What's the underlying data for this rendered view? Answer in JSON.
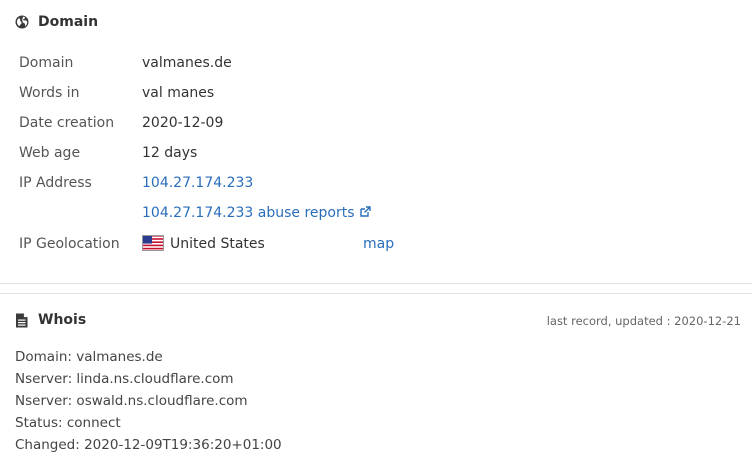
{
  "domain_section": {
    "title": "Domain",
    "rows": {
      "domain": {
        "label": "Domain",
        "value": "valmanes.de"
      },
      "words": {
        "label": "Words in",
        "value": "val manes"
      },
      "date_creation": {
        "label": "Date creation",
        "value": "2020-12-09"
      },
      "web_age": {
        "label": "Web age",
        "value": "12 days"
      },
      "ip_address": {
        "label": "IP Address",
        "value": "104.27.174.233"
      },
      "abuse": {
        "value": "104.27.174.233 abuse reports"
      },
      "geolocation": {
        "label": "IP Geolocation",
        "country": "United States",
        "map_label": "map"
      }
    },
    "icons": {
      "section": "globe-icon",
      "external": "external-link-icon",
      "flag": "us-flag-icon"
    },
    "link_color": "#2a6ebb"
  },
  "whois_section": {
    "title": "Whois",
    "updated": "last record, updated : 2020-12-21",
    "lines": [
      "Domain: valmanes.de",
      "Nserver: linda.ns.cloudflare.com",
      "Nserver: oswald.ns.cloudflare.com",
      "Status: connect",
      "Changed: 2020-12-09T19:36:20+01:00"
    ],
    "icon": "document-icon"
  }
}
